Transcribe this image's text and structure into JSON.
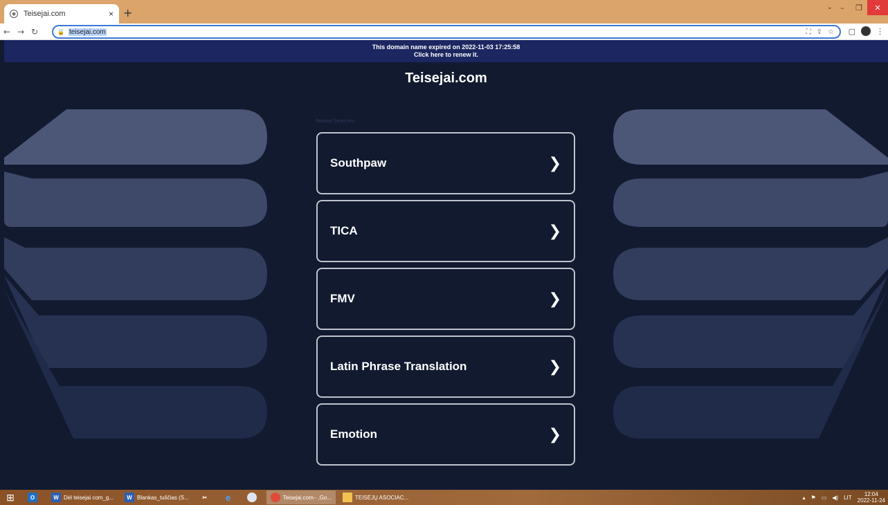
{
  "browser": {
    "tab_title": "Teisejai.com",
    "tab_close": "×",
    "new_tab": "+",
    "url": "teisejai.com"
  },
  "page": {
    "banner_line1": "This domain name expired on 2022-11-03 17:25:58",
    "banner_line2": "Click here to renew it.",
    "site_title": "Teisejai.com",
    "related_label": "Related Searches:",
    "links": [
      {
        "label": "Southpaw"
      },
      {
        "label": "TICA"
      },
      {
        "label": "FMV"
      },
      {
        "label": "Latin Phrase Translation"
      },
      {
        "label": "Emotion"
      }
    ]
  },
  "taskbar": {
    "items": [
      {
        "label": "Dėl teisejai com_g..."
      },
      {
        "label": "Blankas_tuščias (S..."
      },
      {
        "label": "Teisejai.com– ,Go..."
      },
      {
        "label": "TEISĖJŲ ASOCIAC..."
      }
    ],
    "language": "LIT",
    "time": "12:04",
    "date": "2022-11-24"
  },
  "colors": {
    "page_bg": "#121a30",
    "banner_bg": "#1c2660",
    "tabstrip": "#dba46a"
  }
}
